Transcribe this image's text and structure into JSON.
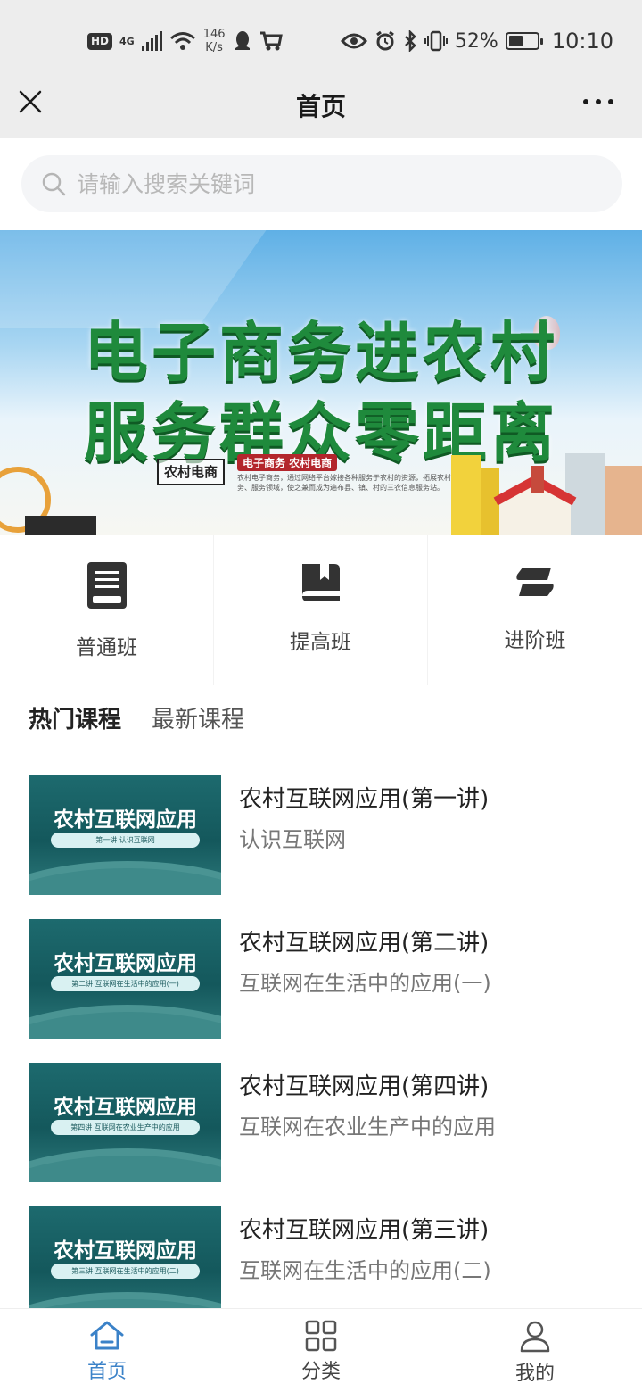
{
  "status_bar": {
    "hd": "HD",
    "network": "4G",
    "speed_value": "146",
    "speed_unit": "K/s",
    "battery": "52%",
    "battery_level": 0.52,
    "time": "10:10"
  },
  "title_bar": {
    "title": "首页"
  },
  "search": {
    "placeholder": "请输入搜索关键词"
  },
  "banner": {
    "line1": "电子商务进农村",
    "line2": "服务群众零距离",
    "stamp": "农村电商",
    "tag": "电子商务 农村电商",
    "desc": "农村电子商务，通过网络平台嫁接各种服务于农村的资源，拓展农村信息服务业务、服务领域，使之兼而成为遍布县、镇、村的三农信息服务站。"
  },
  "categories": [
    {
      "label": "普通班",
      "icon": "book-icon"
    },
    {
      "label": "提高班",
      "icon": "bookmark-book-icon"
    },
    {
      "label": "进阶班",
      "icon": "stack-icon"
    }
  ],
  "tabs": [
    {
      "label": "热门课程",
      "active": true
    },
    {
      "label": "最新课程",
      "active": false
    }
  ],
  "courses": [
    {
      "thumb_title": "农村互联网应用",
      "thumb_sub": "第一讲  认识互联网",
      "title": "农村互联网应用(第一讲)",
      "subtitle": "认识互联网"
    },
    {
      "thumb_title": "农村互联网应用",
      "thumb_sub": "第二讲  互联网在生活中的应用(一)",
      "title": "农村互联网应用(第二讲)",
      "subtitle": "互联网在生活中的应用(一)"
    },
    {
      "thumb_title": "农村互联网应用",
      "thumb_sub": "第四讲  互联网在农业生产中的应用",
      "title": "农村互联网应用(第四讲)",
      "subtitle": "互联网在农业生产中的应用"
    },
    {
      "thumb_title": "农村互联网应用",
      "thumb_sub": "第三讲  互联网在生活中的应用(二)",
      "title": "农村互联网应用(第三讲)",
      "subtitle": "互联网在生活中的应用(二)"
    }
  ],
  "bottom_nav": [
    {
      "label": "首页",
      "icon": "home-icon",
      "active": true
    },
    {
      "label": "分类",
      "icon": "grid-icon",
      "active": false
    },
    {
      "label": "我的",
      "icon": "user-icon",
      "active": false
    }
  ],
  "colors": {
    "accent": "#3b82c8",
    "banner_text": "#1f8a3c",
    "thumb_bg": "#14585c"
  }
}
